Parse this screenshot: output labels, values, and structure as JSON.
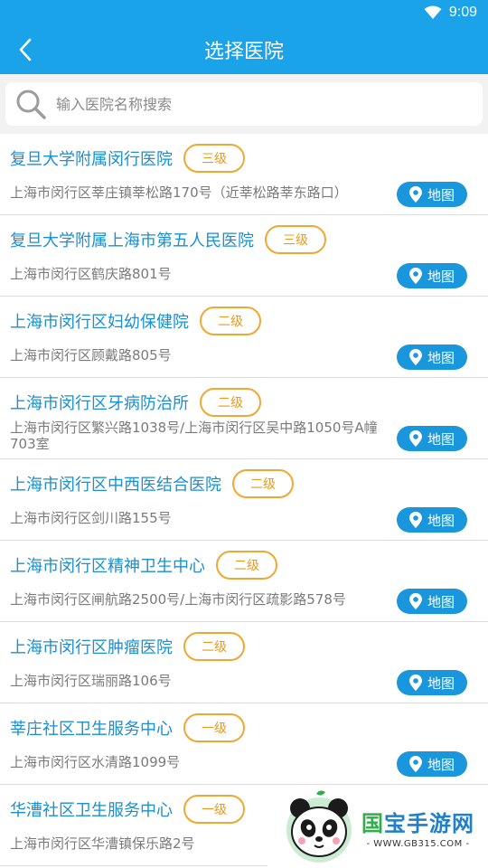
{
  "status_bar": {
    "time": "9:09"
  },
  "nav": {
    "title": "选择医院"
  },
  "search": {
    "placeholder": "输入医院名称搜索"
  },
  "map_label": "地图",
  "hospitals": [
    {
      "name": "复旦大学附属闵行医院",
      "level": "三级",
      "address": "上海市闵行区莘庄镇莘松路170号（近莘松路莘东路口）"
    },
    {
      "name": "复旦大学附属上海市第五人民医院",
      "level": "三级",
      "address": "上海市闵行区鹤庆路801号"
    },
    {
      "name": "上海市闵行区妇幼保健院",
      "level": "二级",
      "address": "上海市闵行区顾戴路805号"
    },
    {
      "name": "上海市闵行区牙病防治所",
      "level": "二级",
      "address": "上海市闵行区繁兴路1038号/上海市闵行区吴中路1050号A幢703室"
    },
    {
      "name": "上海市闵行区中西医结合医院",
      "level": "二级",
      "address": "上海市闵行区剑川路155号"
    },
    {
      "name": "上海市闵行区精神卫生中心",
      "level": "二级",
      "address": "上海市闵行区闸航路2500号/上海市闵行区疏影路578号"
    },
    {
      "name": "上海市闵行区肿瘤医院",
      "level": "二级",
      "address": "上海市闵行区瑞丽路106号"
    },
    {
      "name": "莘庄社区卫生服务中心",
      "level": "一级",
      "address": "上海市闵行区水清路1099号"
    },
    {
      "name": "华漕社区卫生服务中心",
      "level": "一级",
      "address": "上海市闵行区华漕镇保乐路2号"
    }
  ],
  "watermark": {
    "brand_1": "国",
    "brand_2": "宝手游网",
    "url": "- WWW.GB315.COM -"
  },
  "colors": {
    "primary": "#1aa3e8",
    "link": "#1a8fd1",
    "level_border": "#f0a832",
    "map_button": "#1a97dc"
  }
}
